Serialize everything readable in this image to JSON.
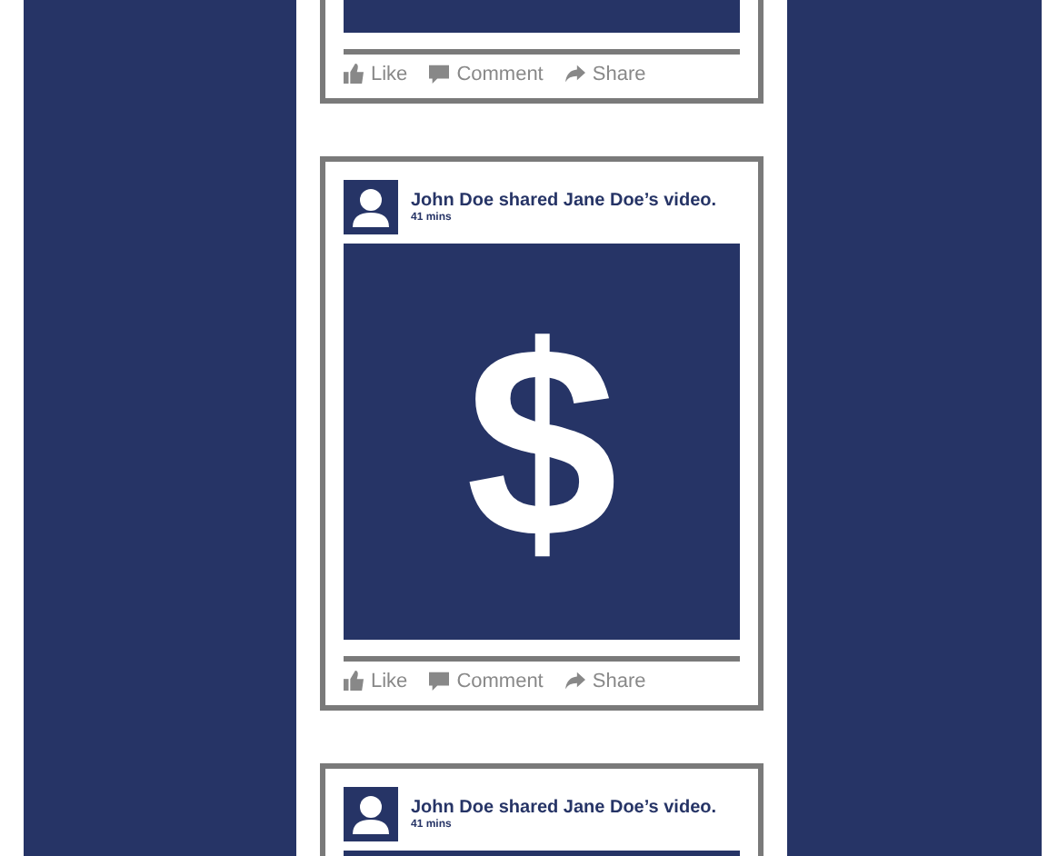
{
  "posts": [
    {
      "media": {
        "kind": "plain"
      },
      "actions": [
        {
          "kind": "like",
          "label": "Like"
        },
        {
          "kind": "comment",
          "label": "Comment"
        },
        {
          "kind": "share",
          "label": "Share"
        }
      ]
    },
    {
      "header": {
        "title": "John Doe shared Jane Doe’s video.",
        "time": "41 mins"
      },
      "media": {
        "kind": "symbol",
        "symbol": "$"
      },
      "actions": [
        {
          "kind": "like",
          "label": "Like"
        },
        {
          "kind": "comment",
          "label": "Comment"
        },
        {
          "kind": "share",
          "label": "Share"
        }
      ]
    },
    {
      "header": {
        "title": "John Doe shared Jane Doe’s video.",
        "time": "41 mins"
      },
      "media": {
        "kind": "plain"
      }
    }
  ]
}
